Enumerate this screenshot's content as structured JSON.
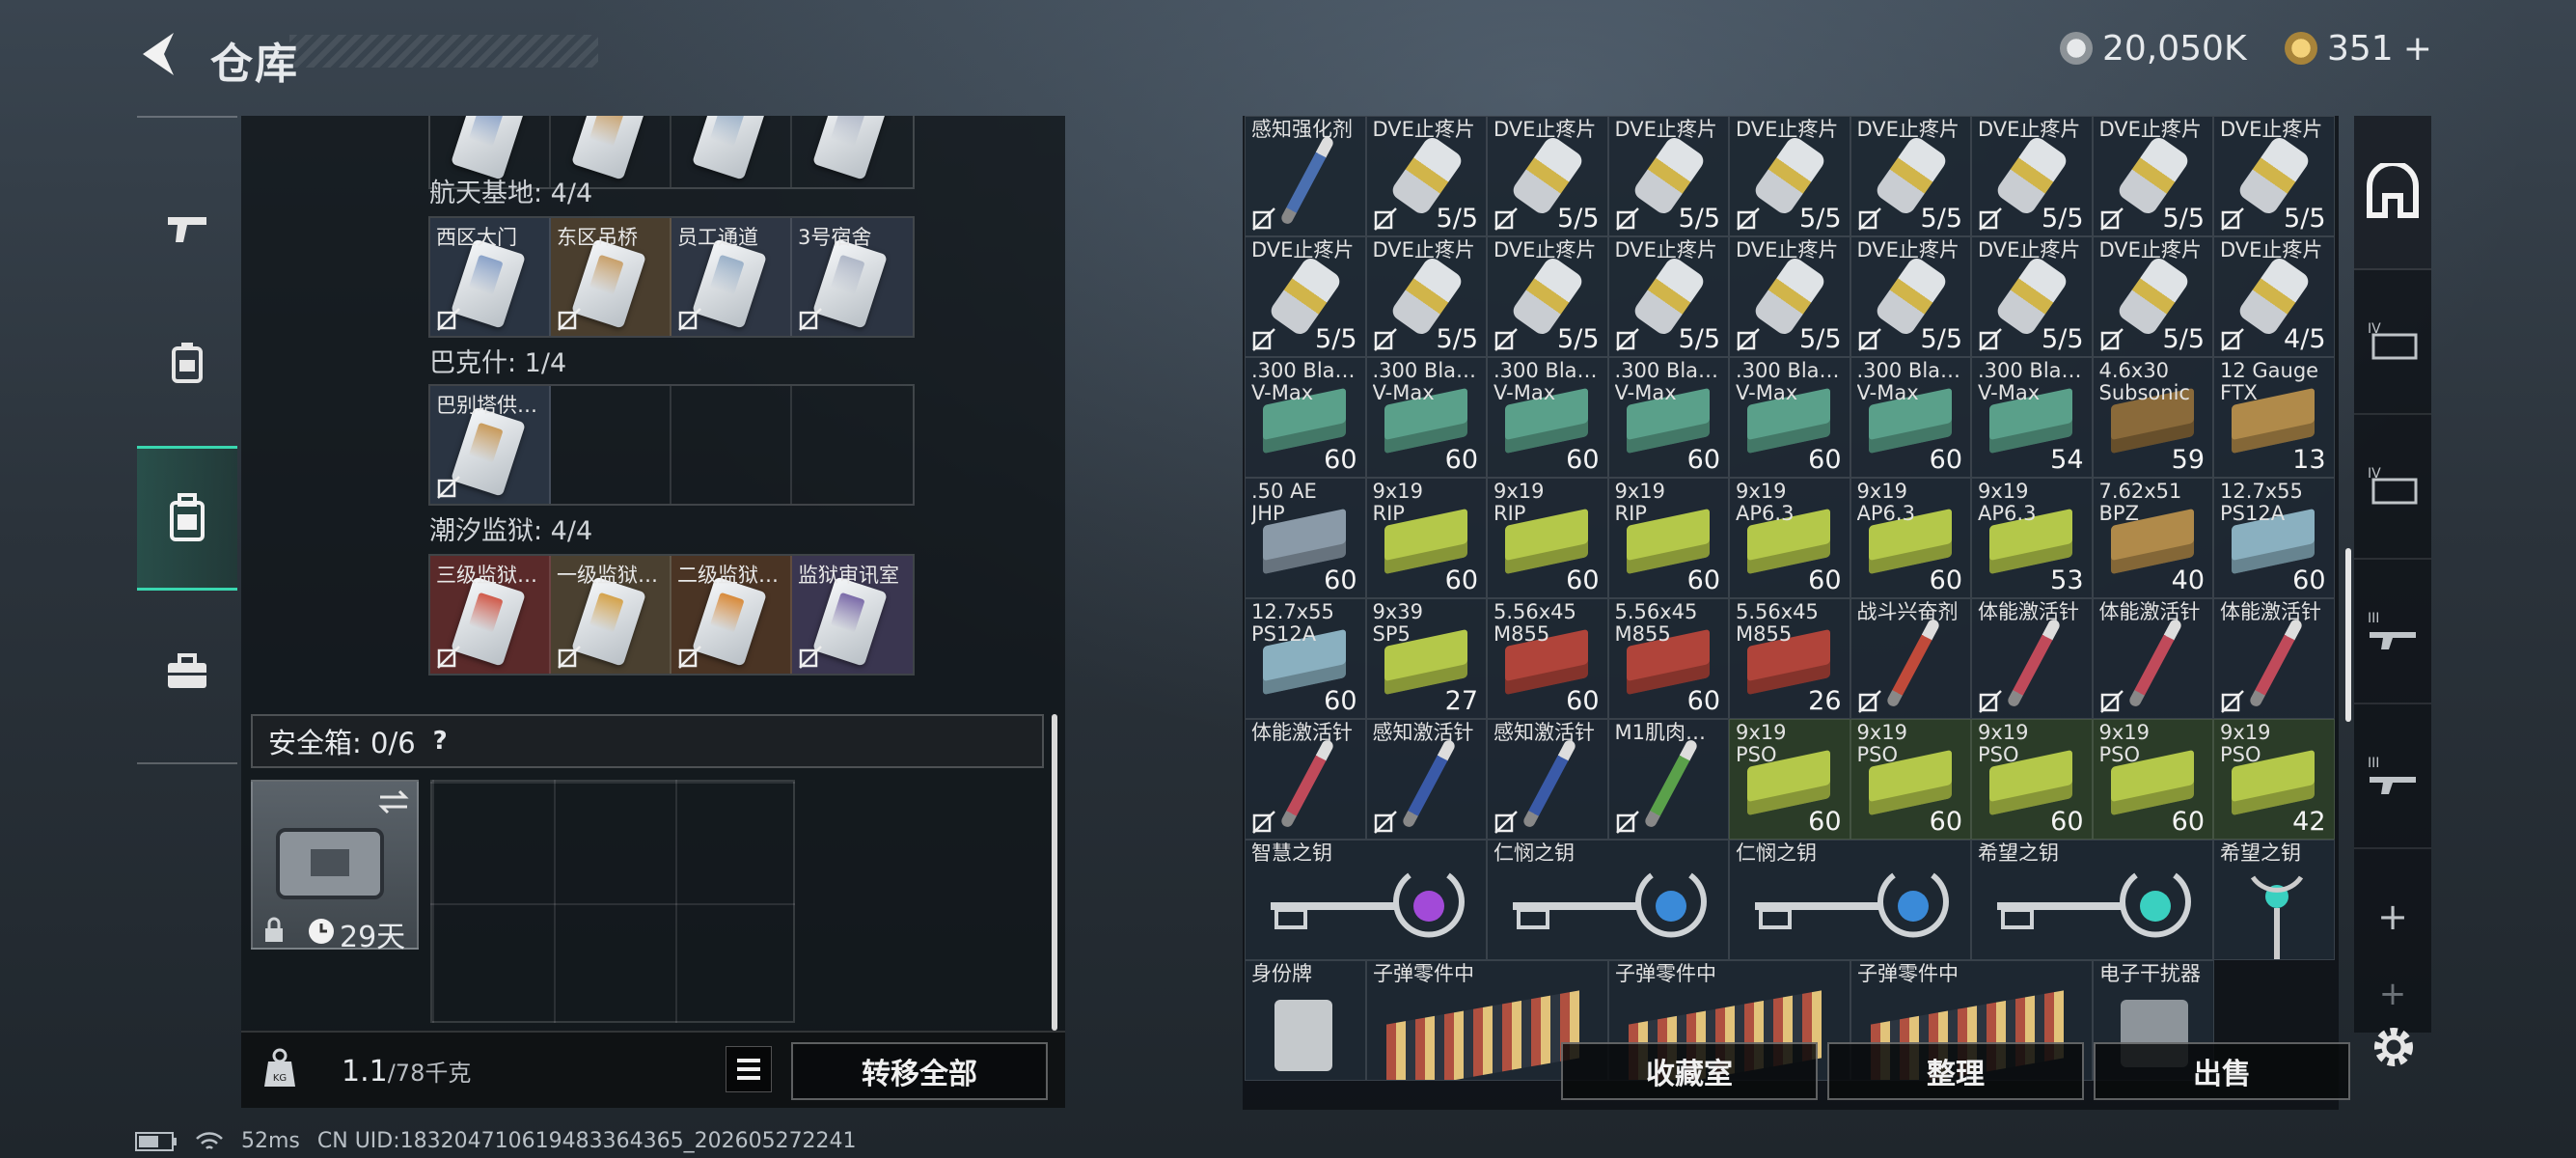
{
  "header": {
    "title": "仓库"
  },
  "currency": {
    "silver": "20,050K",
    "gold": "351",
    "add": "+"
  },
  "nav": {
    "items": [
      "weapon",
      "armor",
      "backpack",
      "case"
    ]
  },
  "left": {
    "groups": [
      {
        "label": "航天基地: 4/4",
        "slots": [
          "西区大门",
          "东区吊桥",
          "员工通道",
          "3号宿舍"
        ],
        "colors": [
          "#8aa2c8",
          "#c8a06a",
          "#9ab0c8",
          "#b0b8c8"
        ]
      },
      {
        "label": "巴克什: 1/4",
        "slots": [
          "巴别塔供…",
          "",
          "",
          ""
        ],
        "colors": [
          "#c89a5a",
          "",
          "",
          ""
        ]
      },
      {
        "label": "潮汐监狱: 4/4",
        "slots": [
          "三级监狱…",
          "一级监狱…",
          "二级监狱…",
          "监狱审讯室"
        ],
        "colors": [
          "#d05a4a",
          "#d4a24a",
          "#d88a3a",
          "#7a6aa8"
        ]
      }
    ],
    "safe_label": "安全箱:",
    "safe_count": "0/6",
    "help": "?",
    "safe_days": "29天",
    "weight_value": "1.1",
    "weight_max": "/78千克",
    "transfer_all": "转移全部"
  },
  "grid": [
    {
      "n": "感知强化剂",
      "c": "",
      "t": "syr",
      "col": "#4a6fb0"
    },
    {
      "n": "DVE止疼片",
      "c": "5/5",
      "t": "pill"
    },
    {
      "n": "DVE止疼片",
      "c": "5/5",
      "t": "pill"
    },
    {
      "n": "DVE止疼片",
      "c": "5/5",
      "t": "pill"
    },
    {
      "n": "DVE止疼片",
      "c": "5/5",
      "t": "pill"
    },
    {
      "n": "DVE止疼片",
      "c": "5/5",
      "t": "pill"
    },
    {
      "n": "DVE止疼片",
      "c": "5/5",
      "t": "pill"
    },
    {
      "n": "DVE止疼片",
      "c": "5/5",
      "t": "pill"
    },
    {
      "n": "DVE止疼片",
      "c": "5/5",
      "t": "pill"
    },
    {
      "n": "DVE止疼片",
      "c": "5/5",
      "t": "pill"
    },
    {
      "n": "DVE止疼片",
      "c": "5/5",
      "t": "pill"
    },
    {
      "n": "DVE止疼片",
      "c": "5/5",
      "t": "pill"
    },
    {
      "n": "DVE止疼片",
      "c": "5/5",
      "t": "pill"
    },
    {
      "n": "DVE止疼片",
      "c": "5/5",
      "t": "pill"
    },
    {
      "n": "DVE止疼片",
      "c": "5/5",
      "t": "pill"
    },
    {
      "n": "DVE止疼片",
      "c": "5/5",
      "t": "pill"
    },
    {
      "n": "DVE止疼片",
      "c": "5/5",
      "t": "pill"
    },
    {
      "n": "DVE止疼片",
      "c": "4/5",
      "t": "pill"
    },
    {
      "n": ".300 Bla…\nV-Max",
      "c": "60",
      "t": "box",
      "col": "#5aa08a"
    },
    {
      "n": ".300 Bla…\nV-Max",
      "c": "60",
      "t": "box",
      "col": "#5aa08a"
    },
    {
      "n": ".300 Bla…\nV-Max",
      "c": "60",
      "t": "box",
      "col": "#5aa08a"
    },
    {
      "n": ".300 Bla…\nV-Max",
      "c": "60",
      "t": "box",
      "col": "#5aa08a"
    },
    {
      "n": ".300 Bla…\nV-Max",
      "c": "60",
      "t": "box",
      "col": "#5aa08a"
    },
    {
      "n": ".300 Bla…\nV-Max",
      "c": "60",
      "t": "box",
      "col": "#5aa08a"
    },
    {
      "n": ".300 Bla…\nV-Max",
      "c": "54",
      "t": "box",
      "col": "#5aa08a"
    },
    {
      "n": "4.6x30\nSubsonic",
      "c": "59",
      "t": "box",
      "col": "#8a6a3a"
    },
    {
      "n": "12 Gauge\nFTX",
      "c": "13",
      "t": "box",
      "col": "#b08a4a"
    },
    {
      "n": ".50 AE\nJHP",
      "c": "60",
      "t": "box",
      "col": "#8a9aa8"
    },
    {
      "n": "9x19\nRIP",
      "c": "60",
      "t": "box",
      "col": "#b4c84a"
    },
    {
      "n": "9x19\nRIP",
      "c": "60",
      "t": "box",
      "col": "#b4c84a"
    },
    {
      "n": "9x19\nRIP",
      "c": "60",
      "t": "box",
      "col": "#b4c84a"
    },
    {
      "n": "9x19\nAP6.3",
      "c": "60",
      "t": "box",
      "col": "#b4c84a"
    },
    {
      "n": "9x19\nAP6.3",
      "c": "60",
      "t": "box",
      "col": "#b4c84a"
    },
    {
      "n": "9x19\nAP6.3",
      "c": "53",
      "t": "box",
      "col": "#b4c84a"
    },
    {
      "n": "7.62x51\nBPZ",
      "c": "40",
      "t": "box",
      "col": "#b08a4a"
    },
    {
      "n": "12.7x55\nPS12A",
      "c": "60",
      "t": "box",
      "col": "#8ab0c0"
    },
    {
      "n": "12.7x55\nPS12A",
      "c": "60",
      "t": "box",
      "col": "#8ab0c0"
    },
    {
      "n": "9x39\nSP5",
      "c": "27",
      "t": "box",
      "col": "#b4c84a"
    },
    {
      "n": "5.56x45\nM855",
      "c": "60",
      "t": "box",
      "col": "#b0443a"
    },
    {
      "n": "5.56x45\nM855",
      "c": "60",
      "t": "box",
      "col": "#b0443a"
    },
    {
      "n": "5.56x45\nM855",
      "c": "26",
      "t": "box",
      "col": "#b0443a"
    },
    {
      "n": "战斗兴奋剂",
      "c": "",
      "t": "syr",
      "col": "#c04a3a"
    },
    {
      "n": "体能激活针",
      "c": "",
      "t": "syr",
      "col": "#c04a5a"
    },
    {
      "n": "体能激活针",
      "c": "",
      "t": "syr",
      "col": "#c04a5a"
    },
    {
      "n": "体能激活针",
      "c": "",
      "t": "syr",
      "col": "#c04a5a"
    },
    {
      "n": "体能激活针",
      "c": "",
      "t": "syr",
      "col": "#c04a5a"
    },
    {
      "n": "感知激活针",
      "c": "",
      "t": "syr",
      "col": "#3a5aa8"
    },
    {
      "n": "感知激活针",
      "c": "",
      "t": "syr",
      "col": "#3a5aa8"
    },
    {
      "n": "M1肌肉…",
      "c": "",
      "t": "syr",
      "col": "#5aa04a"
    },
    {
      "n": "9x19\nPSO",
      "c": "60",
      "t": "box",
      "col": "#b4c84a",
      "g": true
    },
    {
      "n": "9x19\nPSO",
      "c": "60",
      "t": "box",
      "col": "#b4c84a",
      "g": true
    },
    {
      "n": "9x19\nPSO",
      "c": "60",
      "t": "box",
      "col": "#b4c84a",
      "g": true
    },
    {
      "n": "9x19\nPSO",
      "c": "60",
      "t": "box",
      "col": "#b4c84a",
      "g": true
    },
    {
      "n": "9x19\nPSO",
      "c": "42",
      "t": "box",
      "col": "#b4c84a",
      "g": true
    }
  ],
  "keys": [
    {
      "n": "智慧之钥",
      "col": "#a24ad8"
    },
    {
      "n": "仁悯之钥",
      "col": "#3a8ad8"
    },
    {
      "n": "仁悯之钥",
      "col": "#3a8ad8"
    },
    {
      "n": "希望之钥",
      "col": "#3ad0c0"
    },
    {
      "n": "希望之钥",
      "col": "#3ad0c0"
    }
  ],
  "last_row": [
    {
      "n": "身份牌",
      "t": "tag"
    },
    {
      "n": "子弹零件中",
      "t": "parts"
    },
    {
      "n": "子弹零件中",
      "t": "parts"
    },
    {
      "n": "子弹零件中",
      "t": "parts"
    },
    {
      "n": "电子干扰器",
      "t": "jam"
    }
  ],
  "actions": {
    "collection": "收藏室",
    "sort": "整理",
    "sell": "出售"
  },
  "status": {
    "latency": "52ms",
    "uid": "CN UID:18320471061948336436​5_202605272241"
  }
}
